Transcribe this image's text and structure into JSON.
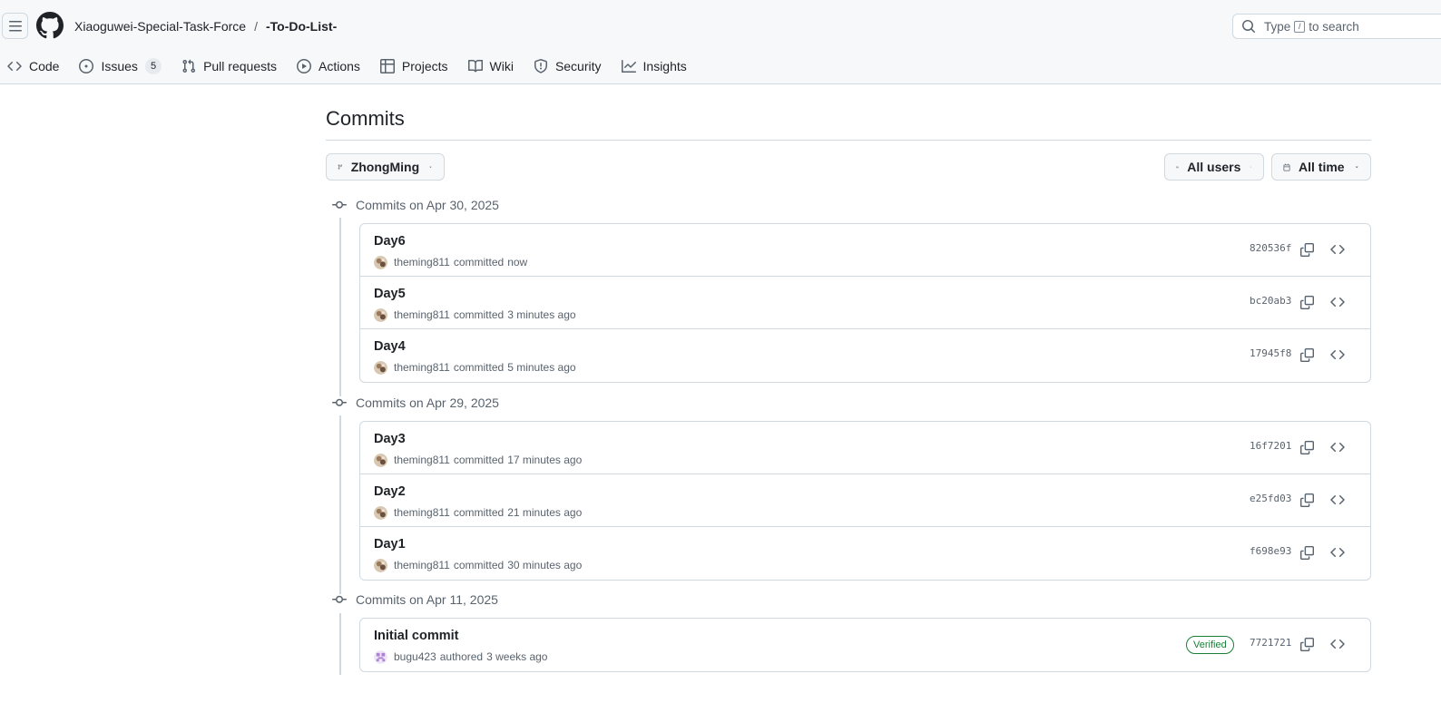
{
  "header": {
    "owner": "Xiaoguwei-Special-Task-Force",
    "separator": "/",
    "repo": "-To-Do-List-",
    "search_prefix": "Type",
    "search_key": "/",
    "search_suffix": "to search"
  },
  "tabs": [
    {
      "label": "Code",
      "icon": "code-icon"
    },
    {
      "label": "Issues",
      "icon": "issue-opened-icon",
      "count": "5"
    },
    {
      "label": "Pull requests",
      "icon": "git-pull-request-icon"
    },
    {
      "label": "Actions",
      "icon": "play-icon"
    },
    {
      "label": "Projects",
      "icon": "table-icon"
    },
    {
      "label": "Wiki",
      "icon": "book-icon"
    },
    {
      "label": "Security",
      "icon": "shield-icon"
    },
    {
      "label": "Insights",
      "icon": "graph-icon"
    }
  ],
  "page": {
    "title": "Commits",
    "branch": "ZhongMing",
    "users_filter": "All users",
    "time_filter": "All time"
  },
  "groups": [
    {
      "heading": "Commits on Apr 30, 2025",
      "commits": [
        {
          "title": "Day6",
          "author": "theming811",
          "verb": "committed",
          "time": "now",
          "sha": "820536f"
        },
        {
          "title": "Day5",
          "author": "theming811",
          "verb": "committed",
          "time": "3 minutes ago",
          "sha": "bc20ab3"
        },
        {
          "title": "Day4",
          "author": "theming811",
          "verb": "committed",
          "time": "5 minutes ago",
          "sha": "17945f8"
        }
      ]
    },
    {
      "heading": "Commits on Apr 29, 2025",
      "commits": [
        {
          "title": "Day3",
          "author": "theming811",
          "verb": "committed",
          "time": "17 minutes ago",
          "sha": "16f7201"
        },
        {
          "title": "Day2",
          "author": "theming811",
          "verb": "committed",
          "time": "21 minutes ago",
          "sha": "e25fd03"
        },
        {
          "title": "Day1",
          "author": "theming811",
          "verb": "committed",
          "time": "30 minutes ago",
          "sha": "f698e93"
        }
      ]
    },
    {
      "heading": "Commits on Apr 11, 2025",
      "commits": [
        {
          "title": "Initial commit",
          "author": "bugu423",
          "verb": "authored",
          "time": "3 weeks ago",
          "sha": "7721721",
          "badge": "Verified"
        }
      ]
    }
  ],
  "colors": {
    "header_bg": "#f6f8fa",
    "border": "#d1d9e0",
    "text": "#1f2328",
    "muted": "#59636e",
    "verified": "#1a7f37"
  }
}
